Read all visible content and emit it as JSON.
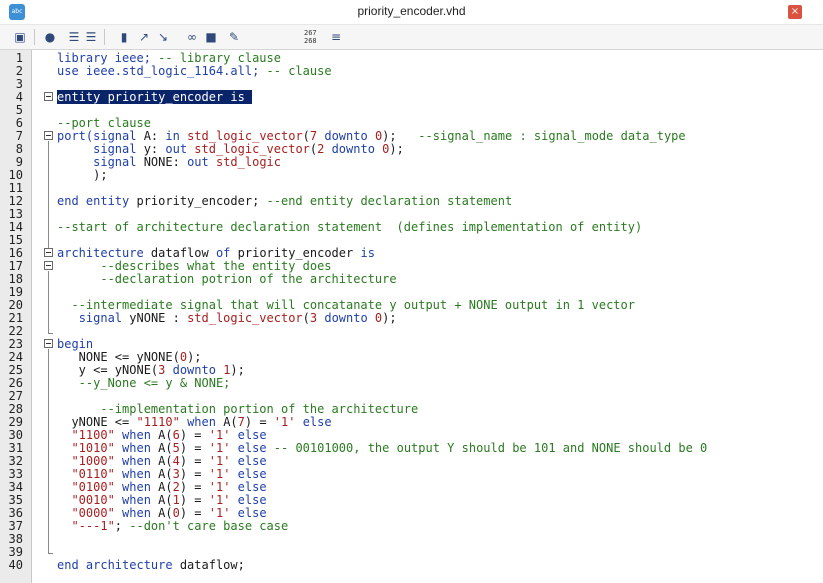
{
  "window": {
    "title": "priority_encoder.vhd",
    "icon": "abc-icon",
    "close_label": "×"
  },
  "toolbar": {
    "buttons": [
      "open-icon",
      "find-icon",
      "indent-icon",
      "outdent-icon",
      "bookmark-icon",
      "bookmark-next-icon",
      "bookmark-prev-icon",
      "attach-icon",
      "terminal-icon",
      "edit-icon"
    ],
    "line_info_top": "267",
    "line_info_bottom": "268"
  },
  "editor": {
    "lines": [
      {
        "n": "1",
        "segs": [
          [
            "k",
            "library ieee; "
          ],
          [
            "c",
            "-- library clause"
          ]
        ]
      },
      {
        "n": "2",
        "segs": [
          [
            "k",
            "use ieee.std_logic_1164.all; "
          ],
          [
            "c",
            "-- clause"
          ]
        ]
      },
      {
        "n": "3",
        "segs": []
      },
      {
        "n": "4",
        "segs": [
          [
            "sel",
            "entity priority_encoder is "
          ]
        ]
      },
      {
        "n": "5",
        "segs": []
      },
      {
        "n": "6",
        "segs": [
          [
            "c",
            "--port clause"
          ]
        ]
      },
      {
        "n": "7",
        "segs": [
          [
            "k",
            "port("
          ],
          [
            "k",
            "signal "
          ],
          [
            "",
            "A: "
          ],
          [
            "k",
            "in "
          ],
          [
            "t",
            "std_logic_vector"
          ],
          [
            "",
            "("
          ],
          [
            "n",
            "7 "
          ],
          [
            "k",
            "downto "
          ],
          [
            "n",
            "0"
          ],
          [
            "",
            "); "
          ],
          [
            "c",
            "  --signal_name : signal_mode data_type"
          ]
        ]
      },
      {
        "n": "8",
        "segs": [
          [
            "",
            "     "
          ],
          [
            "k",
            "signal "
          ],
          [
            "",
            "y: "
          ],
          [
            "k",
            "out "
          ],
          [
            "t",
            "std_logic_vector"
          ],
          [
            "",
            "("
          ],
          [
            "n",
            "2 "
          ],
          [
            "k",
            "downto "
          ],
          [
            "n",
            "0"
          ],
          [
            "",
            ");"
          ]
        ]
      },
      {
        "n": "9",
        "segs": [
          [
            "",
            "     "
          ],
          [
            "k",
            "signal "
          ],
          [
            "",
            "NONE: "
          ],
          [
            "k",
            "out "
          ],
          [
            "t",
            "std_logic"
          ]
        ]
      },
      {
        "n": "10",
        "segs": [
          [
            "",
            "     );"
          ]
        ]
      },
      {
        "n": "11",
        "segs": []
      },
      {
        "n": "12",
        "segs": [
          [
            "k",
            "end entity "
          ],
          [
            "",
            "priority_encoder; "
          ],
          [
            "c",
            "--end entity declaration statement"
          ]
        ]
      },
      {
        "n": "13",
        "segs": []
      },
      {
        "n": "14",
        "segs": [
          [
            "c",
            "--start of architecture declaration statement  (defines implementation of entity)"
          ]
        ]
      },
      {
        "n": "15",
        "segs": []
      },
      {
        "n": "16",
        "segs": [
          [
            "k",
            "architecture "
          ],
          [
            "",
            "dataflow "
          ],
          [
            "k",
            "of "
          ],
          [
            "",
            "priority_encoder "
          ],
          [
            "k",
            "is"
          ]
        ]
      },
      {
        "n": "17",
        "segs": [
          [
            "c",
            "      --describes what the entity does"
          ]
        ]
      },
      {
        "n": "18",
        "segs": [
          [
            "c",
            "      --declaration potrion of the architecture"
          ]
        ]
      },
      {
        "n": "19",
        "segs": []
      },
      {
        "n": "20",
        "segs": [
          [
            "c",
            "  --intermediate signal that will concatanate y output + NONE output in 1 vector"
          ]
        ]
      },
      {
        "n": "21",
        "segs": [
          [
            "",
            "   "
          ],
          [
            "k",
            "signal "
          ],
          [
            "",
            "yNONE : "
          ],
          [
            "t",
            "std_logic_vector"
          ],
          [
            "",
            "("
          ],
          [
            "n",
            "3 "
          ],
          [
            "k",
            "downto "
          ],
          [
            "n",
            "0"
          ],
          [
            "",
            ");"
          ]
        ]
      },
      {
        "n": "22",
        "segs": []
      },
      {
        "n": "23",
        "segs": [
          [
            "k",
            "begin"
          ]
        ]
      },
      {
        "n": "24",
        "segs": [
          [
            "",
            "   NONE <= yNONE("
          ],
          [
            "n",
            "0"
          ],
          [
            "",
            ");"
          ]
        ]
      },
      {
        "n": "25",
        "segs": [
          [
            "",
            "   y <= yNONE("
          ],
          [
            "n",
            "3 "
          ],
          [
            "k",
            "downto "
          ],
          [
            "n",
            "1"
          ],
          [
            "",
            ");"
          ]
        ]
      },
      {
        "n": "26",
        "segs": [
          [
            "c",
            "   --y_None <= y & NONE;"
          ]
        ]
      },
      {
        "n": "27",
        "segs": []
      },
      {
        "n": "28",
        "segs": [
          [
            "c",
            "      --implementation portion of the architecture"
          ]
        ]
      },
      {
        "n": "29",
        "segs": [
          [
            "",
            "  yNONE <= "
          ],
          [
            "t",
            "\"1110\" "
          ],
          [
            "k",
            "when "
          ],
          [
            "",
            "A("
          ],
          [
            "n",
            "7"
          ],
          [
            "",
            ") = "
          ],
          [
            "t",
            "'1' "
          ],
          [
            "k",
            "else"
          ]
        ]
      },
      {
        "n": "30",
        "segs": [
          [
            "t",
            "  \"1100\" "
          ],
          [
            "k",
            "when "
          ],
          [
            "",
            "A("
          ],
          [
            "n",
            "6"
          ],
          [
            "",
            ") = "
          ],
          [
            "t",
            "'1' "
          ],
          [
            "k",
            "else"
          ]
        ]
      },
      {
        "n": "31",
        "segs": [
          [
            "t",
            "  \"1010\" "
          ],
          [
            "k",
            "when "
          ],
          [
            "",
            "A("
          ],
          [
            "n",
            "5"
          ],
          [
            "",
            ") = "
          ],
          [
            "t",
            "'1' "
          ],
          [
            "k",
            "else "
          ],
          [
            "c",
            "-- 00101000, the output Y should be 101 and NONE should be 0"
          ]
        ]
      },
      {
        "n": "32",
        "segs": [
          [
            "t",
            "  \"1000\" "
          ],
          [
            "k",
            "when "
          ],
          [
            "",
            "A("
          ],
          [
            "n",
            "4"
          ],
          [
            "",
            ") = "
          ],
          [
            "t",
            "'1' "
          ],
          [
            "k",
            "else"
          ]
        ]
      },
      {
        "n": "33",
        "segs": [
          [
            "t",
            "  \"0110\" "
          ],
          [
            "k",
            "when "
          ],
          [
            "",
            "A("
          ],
          [
            "n",
            "3"
          ],
          [
            "",
            ") = "
          ],
          [
            "t",
            "'1' "
          ],
          [
            "k",
            "else"
          ]
        ]
      },
      {
        "n": "34",
        "segs": [
          [
            "t",
            "  \"0100\" "
          ],
          [
            "k",
            "when "
          ],
          [
            "",
            "A("
          ],
          [
            "n",
            "2"
          ],
          [
            "",
            ") = "
          ],
          [
            "t",
            "'1' "
          ],
          [
            "k",
            "else"
          ]
        ]
      },
      {
        "n": "35",
        "segs": [
          [
            "t",
            "  \"0010\" "
          ],
          [
            "k",
            "when "
          ],
          [
            "",
            "A("
          ],
          [
            "n",
            "1"
          ],
          [
            "",
            ") = "
          ],
          [
            "t",
            "'1' "
          ],
          [
            "k",
            "else"
          ]
        ]
      },
      {
        "n": "36",
        "segs": [
          [
            "t",
            "  \"0000\" "
          ],
          [
            "k",
            "when "
          ],
          [
            "",
            "A("
          ],
          [
            "n",
            "0"
          ],
          [
            "",
            ") = "
          ],
          [
            "t",
            "'1' "
          ],
          [
            "k",
            "else"
          ]
        ]
      },
      {
        "n": "37",
        "segs": [
          [
            "t",
            "  \"---1\""
          ],
          [
            "",
            "; "
          ],
          [
            "c",
            "--don't care base case"
          ]
        ]
      },
      {
        "n": "38",
        "segs": []
      },
      {
        "n": "39",
        "segs": []
      },
      {
        "n": "40",
        "segs": [
          [
            "k",
            "end architecture "
          ],
          [
            "",
            "dataflow;"
          ]
        ]
      }
    ]
  }
}
